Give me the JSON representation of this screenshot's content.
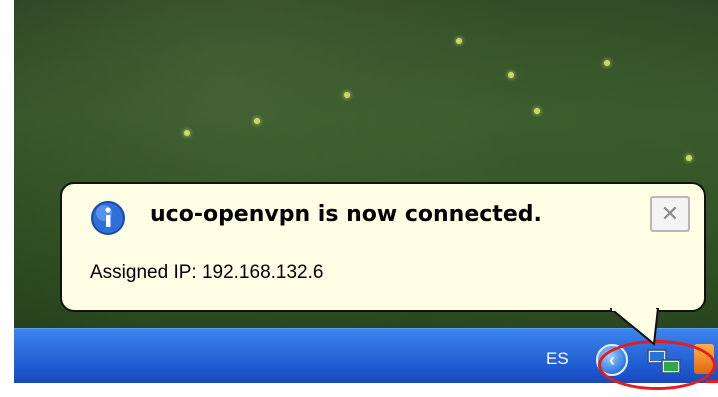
{
  "notification": {
    "title": "uco-openvpn is now connected.",
    "body": "Assigned IP: 192.168.132.6",
    "icon": "info-icon",
    "close_symbol": "✕"
  },
  "taskbar": {
    "language": "ES",
    "tray_expand_symbol": "‹",
    "tray_icons": [
      "network-icon",
      "app-icon"
    ]
  },
  "colors": {
    "balloon_background": "#fefee4",
    "taskbar_blue": "#2f6fde",
    "highlight_red": "#e41c1c"
  }
}
